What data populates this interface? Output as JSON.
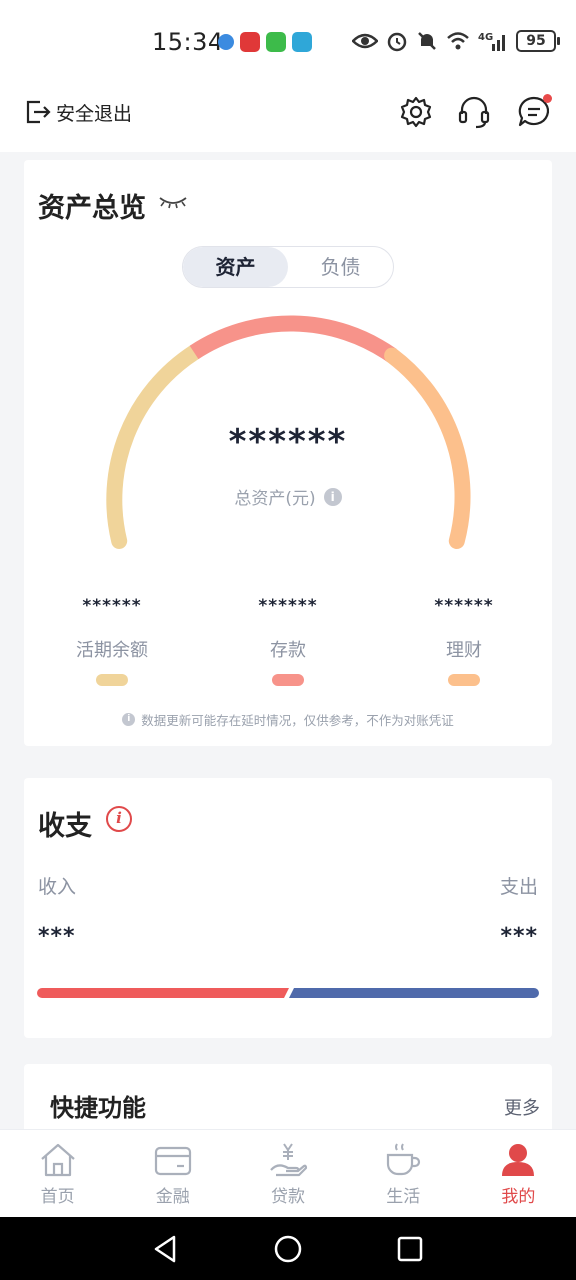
{
  "status_bar": {
    "time": "15:34",
    "battery": "95",
    "network": "4G"
  },
  "header": {
    "logout_label": "安全退出"
  },
  "assets": {
    "title": "资产总览",
    "tabs": [
      "资产",
      "负债"
    ],
    "active_tab": "资产",
    "total_value": "******",
    "total_label": "总资产(元)",
    "buckets": [
      {
        "value": "******",
        "label": "活期余额",
        "color": "#f0d49a"
      },
      {
        "value": "******",
        "label": "存款",
        "color": "#f7938a"
      },
      {
        "value": "******",
        "label": "理财",
        "color": "#fcc08c"
      }
    ],
    "disclaimer": "数据更新可能存在延时情况，仅供参考，不作为对账凭证"
  },
  "income": {
    "title": "收支",
    "income_label": "收入",
    "expense_label": "支出",
    "income_value": "***",
    "expense_value": "***",
    "income_color": "#ef5b5b",
    "expense_color": "#4f6aab"
  },
  "quick": {
    "title": "快捷功能",
    "more_label": "更多"
  },
  "nav": {
    "items": [
      {
        "label": "首页",
        "icon": "home-icon"
      },
      {
        "label": "金融",
        "icon": "card-icon"
      },
      {
        "label": "贷款",
        "icon": "loan-icon"
      },
      {
        "label": "生活",
        "icon": "cup-icon"
      },
      {
        "label": "我的",
        "icon": "person-icon"
      }
    ],
    "active": "我的",
    "active_color": "#e0494a"
  }
}
